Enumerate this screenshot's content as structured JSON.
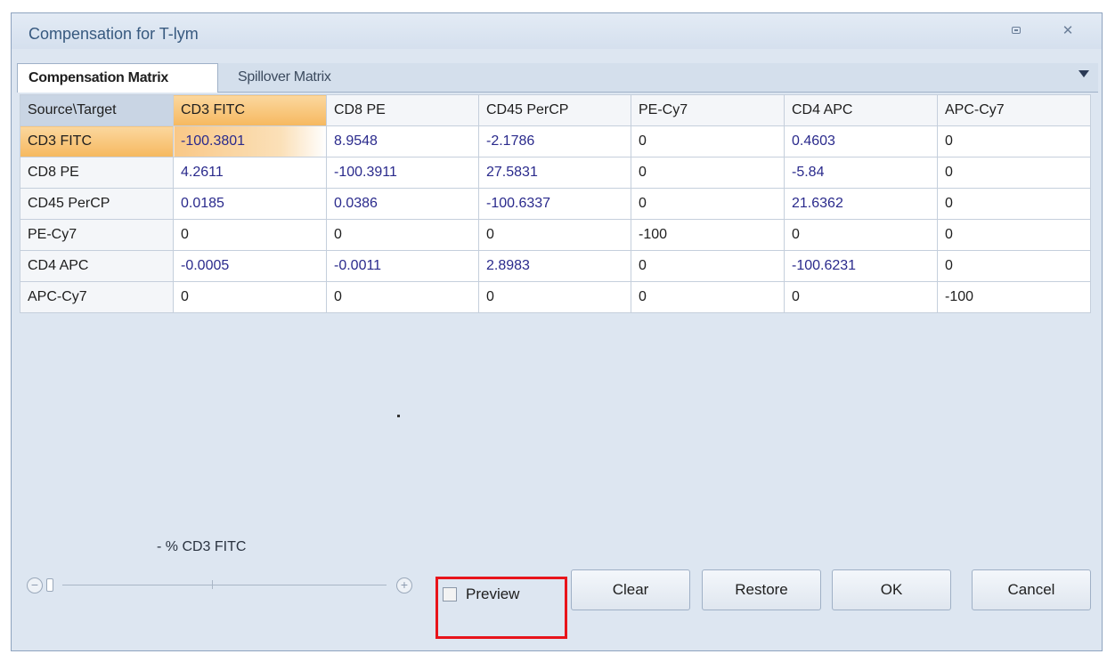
{
  "window": {
    "title": "Compensation for T-lym"
  },
  "tabs": {
    "active": "Compensation Matrix",
    "inactive": "Spillover Matrix"
  },
  "grid": {
    "corner": "Source\\Target",
    "columns": [
      "CD3 FITC",
      "CD8 PE",
      "CD45 PerCP",
      "PE-Cy7",
      "CD4 APC",
      "APC-Cy7"
    ],
    "rows": [
      {
        "label": "CD3 FITC",
        "cells": [
          "-100.3801",
          "8.9548",
          "-2.1786",
          "0",
          "0.4603",
          "0"
        ]
      },
      {
        "label": "CD8 PE",
        "cells": [
          "4.2611",
          "-100.3911",
          "27.5831",
          "0",
          "-5.84",
          "0"
        ]
      },
      {
        "label": "CD45 PerCP",
        "cells": [
          "0.0185",
          "0.0386",
          "-100.6337",
          "0",
          "21.6362",
          "0"
        ]
      },
      {
        "label": "PE-Cy7",
        "cells": [
          "0",
          "0",
          "0",
          "-100",
          "0",
          "0"
        ]
      },
      {
        "label": "CD4 APC",
        "cells": [
          "-0.0005",
          "-0.0011",
          "2.8983",
          "0",
          "-100.6231",
          "0"
        ]
      },
      {
        "label": "APC-Cy7",
        "cells": [
          "0",
          "0",
          "0",
          "0",
          "0",
          "-100"
        ]
      }
    ]
  },
  "zoom": {
    "label": "- % CD3 FITC"
  },
  "preview": {
    "label": "Preview",
    "checked": false
  },
  "buttons": {
    "clear": "Clear",
    "restore": "Restore",
    "ok": "OK",
    "cancel": "Cancel"
  }
}
